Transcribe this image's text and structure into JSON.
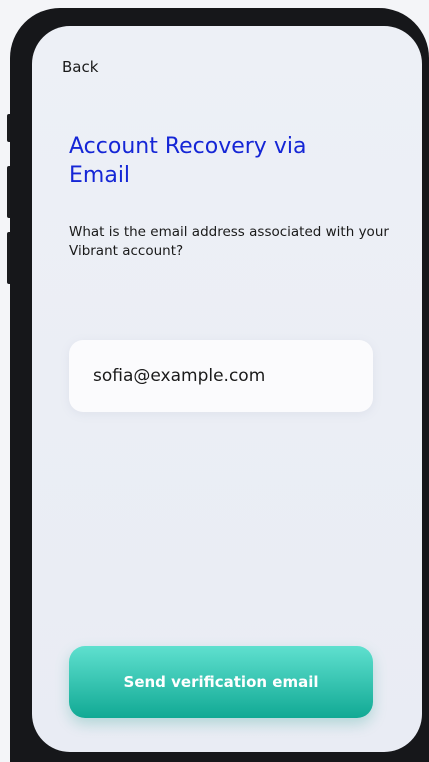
{
  "nav": {
    "back_label": "Back"
  },
  "page": {
    "title": "Account Recovery via Email",
    "prompt": "What is the email address associated with your Vibrant account?"
  },
  "email_field": {
    "value": "sofia@example.com"
  },
  "actions": {
    "send_label": "Send verification email"
  },
  "colors": {
    "title": "#1526d6",
    "button_top": "#5fe0cf",
    "button_bottom": "#11a994",
    "screen_bg": "#edf0f6",
    "phone_frame": "#16171a"
  }
}
